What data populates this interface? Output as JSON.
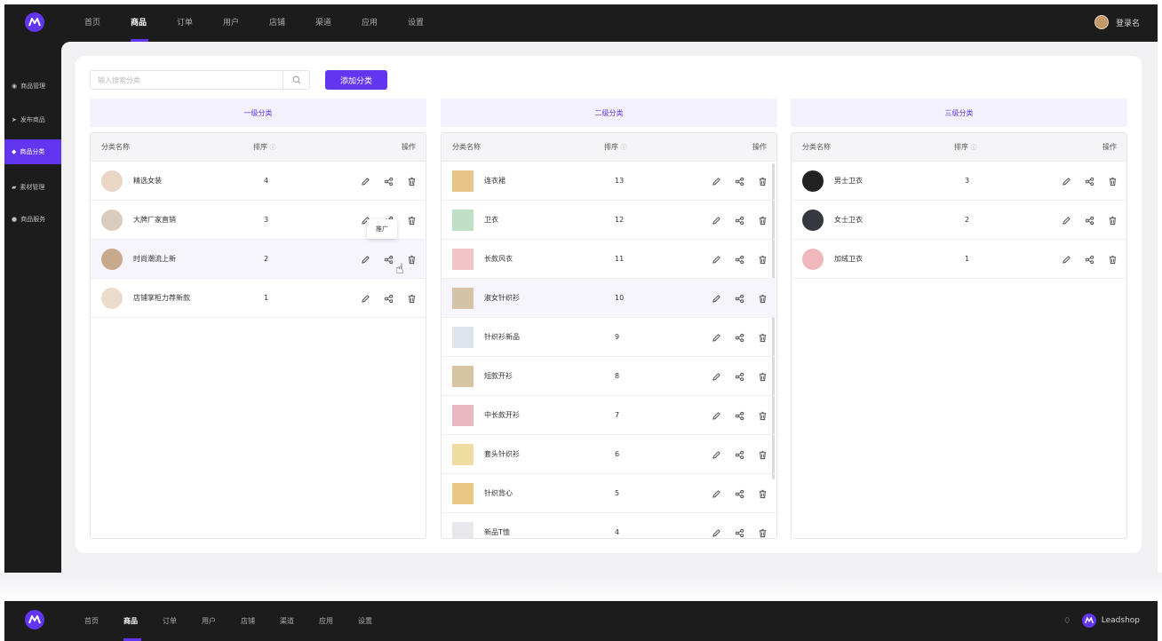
{
  "app": {
    "nav": [
      "首页",
      "商品",
      "订单",
      "用户",
      "店铺",
      "渠道",
      "应用",
      "设置"
    ],
    "active_nav": "商品",
    "user_name": "登录名"
  },
  "sidebar": {
    "items": [
      {
        "label": "商品管理",
        "icon": "bag-icon"
      },
      {
        "label": "发布商品",
        "icon": "send-icon"
      },
      {
        "label": "商品分类",
        "icon": "category-icon",
        "active": true
      },
      {
        "label": "素材管理",
        "icon": "folder-icon"
      },
      {
        "label": "商品服务",
        "icon": "service-icon"
      }
    ]
  },
  "toolbar": {
    "search_placeholder": "输入搜索分类",
    "add_label": "添加分类"
  },
  "table_headers": {
    "name": "分类名称",
    "sort": "排序",
    "actions": "操作"
  },
  "levels": [
    "一级分类",
    "二级分类",
    "三级分类"
  ],
  "level1": [
    {
      "name": "精选女装",
      "sort": "4"
    },
    {
      "name": "大牌厂家直销",
      "sort": "3"
    },
    {
      "name": "时尚潮流上新",
      "sort": "2"
    },
    {
      "name": "店铺掌柜力荐新款",
      "sort": "1"
    }
  ],
  "level2": [
    {
      "name": "连衣裙",
      "sort": "13"
    },
    {
      "name": "卫衣",
      "sort": "12"
    },
    {
      "name": "长款风衣",
      "sort": "11"
    },
    {
      "name": "淑女针织衫",
      "sort": "10"
    },
    {
      "name": "针织衫新品",
      "sort": "9"
    },
    {
      "name": "短款开衫",
      "sort": "8"
    },
    {
      "name": "中长款开衫",
      "sort": "7"
    },
    {
      "name": "套头针织衫",
      "sort": "6"
    },
    {
      "name": "针织背心",
      "sort": "5"
    },
    {
      "name": "新品T恤",
      "sort": "4"
    }
  ],
  "level3": [
    {
      "name": "男士卫衣",
      "sort": "3"
    },
    {
      "name": "女士卫衣",
      "sort": "2"
    },
    {
      "name": "加绒卫衣",
      "sort": "1"
    }
  ],
  "tooltip": "推广",
  "bottom": {
    "nav": [
      "首页",
      "商品",
      "订单",
      "用户",
      "店铺",
      "渠道",
      "应用",
      "设置"
    ],
    "active_nav": "商品",
    "brand": "Leadshop"
  },
  "colors": {
    "accent": "#6236f0",
    "dark": "#1c1c1c",
    "level_bg": "#f3f1fe"
  }
}
